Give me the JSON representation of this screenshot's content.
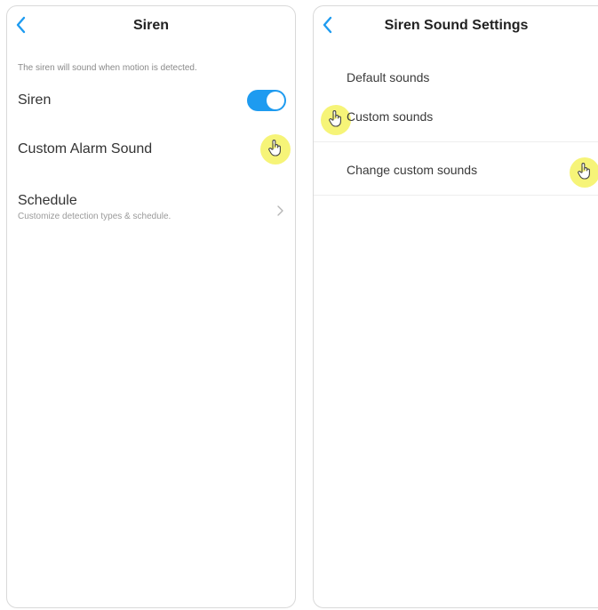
{
  "left_screen": {
    "title": "Siren",
    "hint": "The siren will sound when motion is detected.",
    "siren_label": "Siren",
    "siren_enabled": true,
    "custom_alarm_label": "Custom Alarm Sound",
    "schedule_label": "Schedule",
    "schedule_sub": "Customize detection types & schedule."
  },
  "right_screen": {
    "title": "Siren Sound Settings",
    "default_sounds_label": "Default sounds",
    "custom_sounds_label": "Custom sounds",
    "change_custom_label": "Change custom sounds"
  },
  "colors": {
    "accent": "#1e9bf0",
    "cursor_highlight": "#f6f36a"
  },
  "icons": {
    "back": "chevron-left-icon",
    "pointer": "hand-pointer-icon",
    "row_chevron": "chevron-right-icon"
  }
}
